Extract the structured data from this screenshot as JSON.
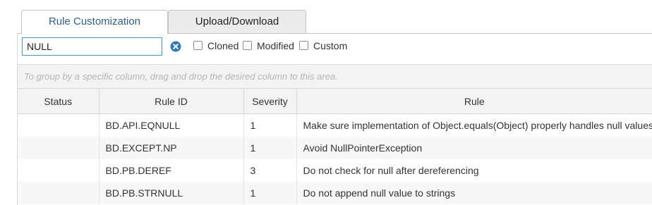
{
  "tabs": [
    {
      "label": "Rule Customization",
      "active": true
    },
    {
      "label": "Upload/Download",
      "active": false
    }
  ],
  "filter": {
    "search_value": "NULL",
    "clear_icon": "close-circle-icon",
    "checkboxes": [
      {
        "label": "Cloned",
        "checked": false
      },
      {
        "label": "Modified",
        "checked": false
      },
      {
        "label": "Custom",
        "checked": false
      }
    ]
  },
  "grid": {
    "group_hint": "To group by a specific column, drag and drop the desired column to this area.",
    "columns": [
      "Status",
      "Rule ID",
      "Severity",
      "Rule"
    ],
    "rows": [
      {
        "status": "",
        "rule_id": "BD.API.EQNULL",
        "severity": "1",
        "rule": "Make sure implementation of Object.equals(Object) properly handles null values"
      },
      {
        "status": "",
        "rule_id": "BD.EXCEPT.NP",
        "severity": "1",
        "rule": "Avoid NullPointerException"
      },
      {
        "status": "",
        "rule_id": "BD.PB.DEREF",
        "severity": "3",
        "rule": "Do not check for null after dereferencing"
      },
      {
        "status": "",
        "rule_id": "BD.PB.STRNULL",
        "severity": "1",
        "rule": "Do not append null value to strings"
      }
    ]
  },
  "colors": {
    "accent": "#2f79b7",
    "tab_active_text": "#2f5f8a",
    "header_bg": "#f3f3f3"
  }
}
